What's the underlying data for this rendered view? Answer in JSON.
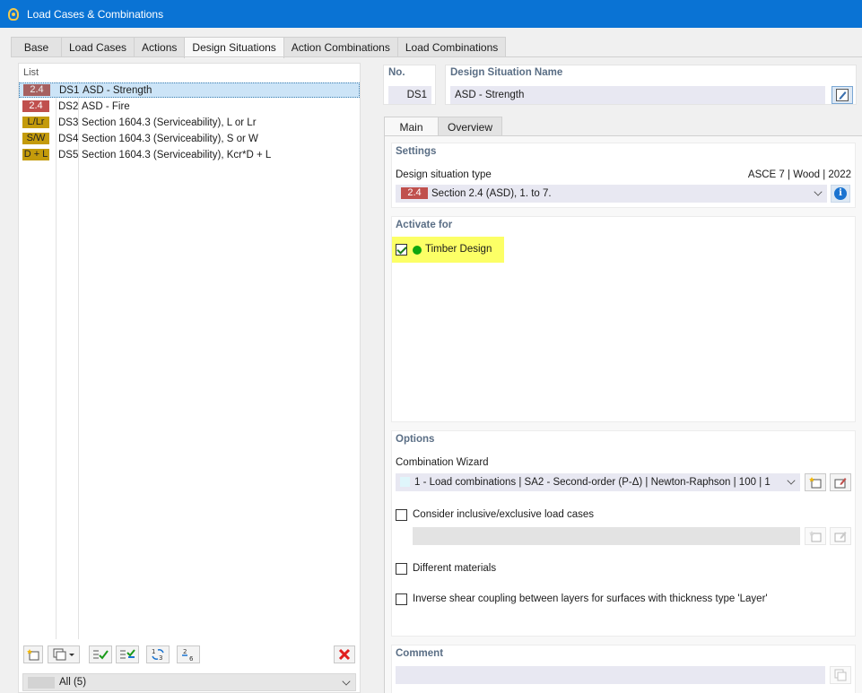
{
  "window": {
    "title": "Load Cases & Combinations"
  },
  "tabs": [
    {
      "label": "Base"
    },
    {
      "label": "Load Cases"
    },
    {
      "label": "Actions"
    },
    {
      "label": "Design Situations"
    },
    {
      "label": "Action Combinations"
    },
    {
      "label": "Load Combinations"
    }
  ],
  "list": {
    "header": "List",
    "items": [
      {
        "badge": "2.4",
        "code": "DS1",
        "name": "ASD - Strength"
      },
      {
        "badge": "2.4",
        "code": "DS2",
        "name": "ASD - Fire"
      },
      {
        "badge": "L/Lr",
        "code": "DS3",
        "name": "Section 1604.3 (Serviceability), L or Lr"
      },
      {
        "badge": "S/W",
        "code": "DS4",
        "name": "Section 1604.3 (Serviceability), S or W"
      },
      {
        "badge": "D + L",
        "code": "DS5",
        "name": "Section 1604.3 (Serviceability), Kcr*D + L"
      }
    ],
    "filter": "All (5)"
  },
  "header": {
    "no_label": "No.",
    "no_value": "DS1",
    "name_label": "Design Situation Name",
    "name_value": "ASD - Strength"
  },
  "subtabs": [
    {
      "label": "Main"
    },
    {
      "label": "Overview"
    }
  ],
  "settings": {
    "title": "Settings",
    "type_label": "Design situation type",
    "standard": "ASCE 7 | Wood | 2022",
    "type_badge": "2.4",
    "type_value": "Section 2.4 (ASD), 1. to 7."
  },
  "activate": {
    "title": "Activate for",
    "item": "Timber Design"
  },
  "options": {
    "title": "Options",
    "wizard_label": "Combination Wizard",
    "wizard_value": "1 - Load combinations | SA2 - Second-order (P-Δ) | Newton-Raphson | 100 | 1",
    "inclusive_label": "Consider inclusive/exclusive load cases",
    "different_materials": "Different materials",
    "inverse_shear": "Inverse shear coupling between layers for surfaces with thickness type 'Layer'"
  },
  "comment": {
    "title": "Comment"
  },
  "colors": {
    "titlebar": "#0a73d4",
    "badge_red": "#c0504d",
    "badge_gold": "#c49b0b",
    "highlight": "#fcff66",
    "section_title": "#5a6e85"
  }
}
